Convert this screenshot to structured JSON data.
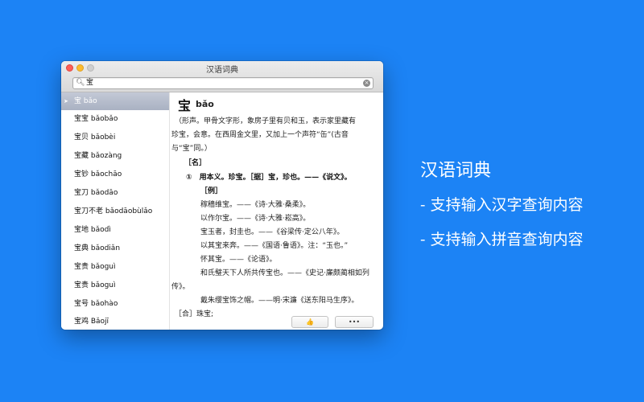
{
  "window": {
    "title": "汉语词典"
  },
  "search": {
    "value": "宝"
  },
  "list": {
    "items": [
      {
        "label": "宝 bǎo",
        "selected": true
      },
      {
        "label": "宝宝 bǎobǎo"
      },
      {
        "label": "宝贝 bǎobèi"
      },
      {
        "label": "宝藏 bǎozàng"
      },
      {
        "label": "宝钞 bǎochāo"
      },
      {
        "label": "宝刀 bǎodāo"
      },
      {
        "label": "宝刀不老 bǎodāobùlǎo"
      },
      {
        "label": "宝地 bǎodì"
      },
      {
        "label": "宝典 bǎodiǎn"
      },
      {
        "label": "宝贵 bǎoguì"
      },
      {
        "label": "宝贵 bǎoguì"
      },
      {
        "label": "宝号 bǎohào"
      },
      {
        "label": "宝鸡 Bǎojī"
      }
    ]
  },
  "entry": {
    "headword": "宝",
    "pinyin": "bǎo",
    "lines": [
      "（形声。甲骨文字形，象房子里有贝和玉，表示家里藏有",
      "珍宝，会意。在西周金文里，又加上一个声符“缶”(古音",
      "与“宝”同。）",
      "［名］",
      "①　用本义。珍宝。［据］宝，珍也。——《说文》。",
      "［例］",
      "稼穑维宝。——《诗·大雅·桑柔》。",
      "以作尔宝。——《诗·大雅·崧高》。",
      "宝玉者，封圭也。——《谷梁传·定公八年》。",
      "以其宝来奔。——《国语·鲁语》。注：“玉也。”",
      "怀其宝。——《论语》。",
      "和氏璧天下人所共传宝也。——《史记·廉颇蔺相如列",
      "传》。",
      "戴朱缨宝饰之帽。——明·宋濂《送东阳马生序》。",
      "［合］珠宝;"
    ]
  },
  "buttons": {
    "like_glyph": "👍",
    "more_glyph": "•••"
  },
  "promo": {
    "heading": "汉语词典",
    "point1": "- 支持输入汉字查询内容",
    "point2": "- 支持输入拼音查询内容"
  }
}
